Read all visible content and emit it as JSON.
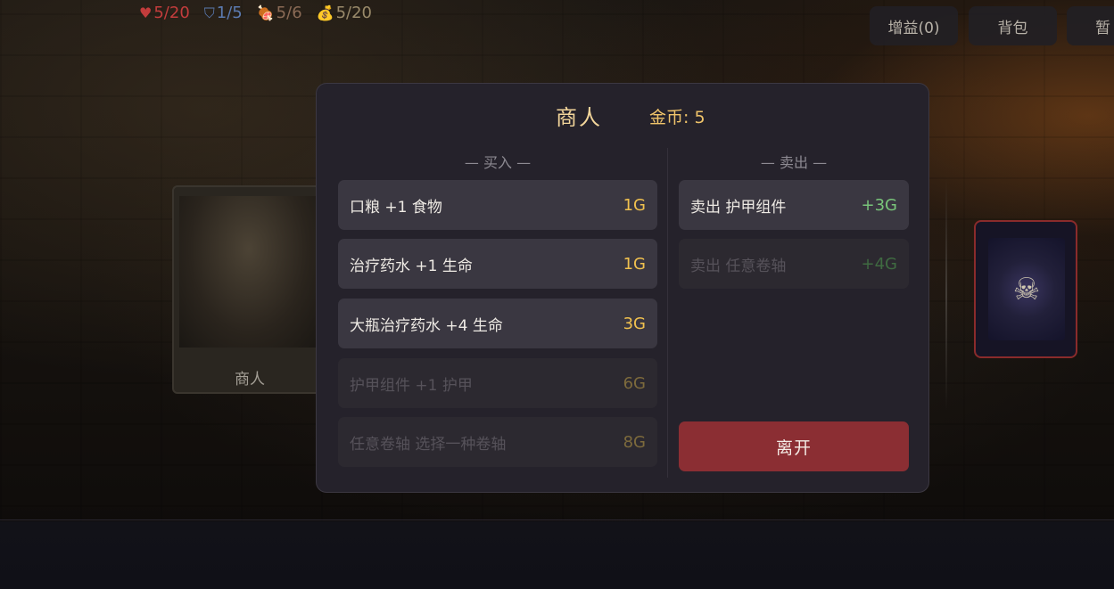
{
  "hud": {
    "health": "5/20",
    "armor": "1/5",
    "food": "5/6",
    "gold": "5/20",
    "buffs_label": "增益(0)",
    "bag_label": "背包",
    "pause_label": "暂"
  },
  "scene": {
    "left_card_label": "商人"
  },
  "shop": {
    "title": "商人",
    "gold_label": "金币: 5",
    "buy_header": "— 买入 —",
    "sell_header": "— 卖出 —",
    "buy_items": [
      {
        "name": "口粮 +1 食物",
        "price": "1G",
        "enabled": true
      },
      {
        "name": "治疗药水 +1 生命",
        "price": "1G",
        "enabled": true
      },
      {
        "name": "大瓶治疗药水 +4 生命",
        "price": "3G",
        "enabled": true
      },
      {
        "name": "护甲组件 +1 护甲",
        "price": "6G",
        "enabled": false
      },
      {
        "name": "任意卷轴 选择一种卷轴",
        "price": "8G",
        "enabled": false
      }
    ],
    "sell_items": [
      {
        "name": "卖出 护甲组件",
        "price": "+3G",
        "enabled": true
      },
      {
        "name": "卖出 任意卷轴",
        "price": "+4G",
        "enabled": false
      }
    ],
    "leave_label": "离开"
  },
  "colors": {
    "accent_gold": "#f0c14f",
    "sell_green": "#79c57a",
    "leave_red": "#8b2e33",
    "title_gold": "#f3d69b"
  },
  "icons": [
    "heart-icon",
    "shield-icon",
    "meat-icon",
    "money-bag-icon",
    "skull-seal-icon"
  ]
}
